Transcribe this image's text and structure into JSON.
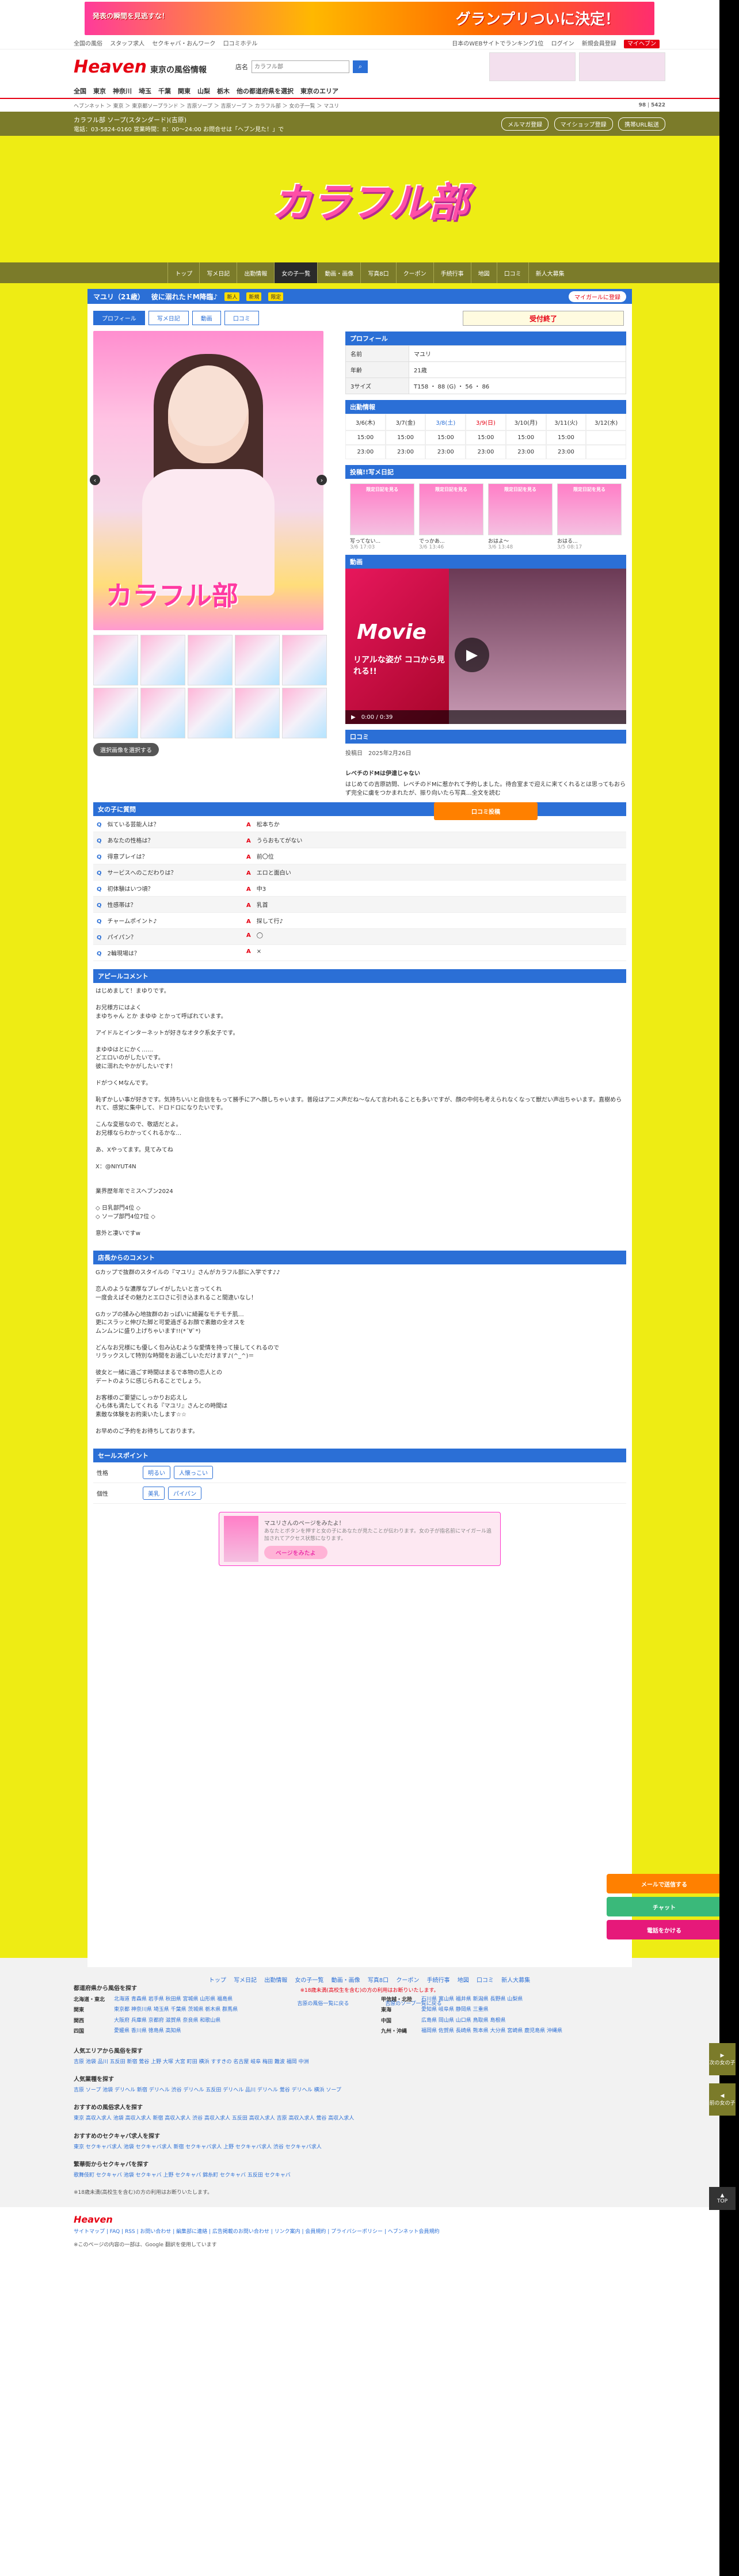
{
  "banner": {
    "left_text": "発表の瞬間を見逃すな！",
    "right_text": "グランプリついに決定！"
  },
  "topbar": {
    "left": [
      "全国の風俗",
      "スタッフ求人",
      "セクキャバ・おんワーク",
      "口コミホテル"
    ],
    "right": [
      "日本のWEBサイトでランキング1位",
      "ログイン",
      "新規会員登録",
      "マイヘブン"
    ]
  },
  "header": {
    "logo": "Heaven",
    "area": "東京の風俗情報",
    "search_label": "店名",
    "search_placeholder": "カラフル部"
  },
  "gnav": [
    "全国",
    "東京",
    "神奈川",
    "埼玉",
    "千葉",
    "関東",
    "山梨",
    "栃木",
    "他の都道府県を選択",
    "東京のエリア"
  ],
  "crumb": {
    "path": "ヘブンネット ＞ 東京 ＞ 東京都ソープランド ＞ 吉原ソープ ＞ 吉原ソープ ＞ カラフル部 ＞ 女の子一覧 ＞ マユリ",
    "count_a": "98",
    "count_b": "5422"
  },
  "shop": {
    "name": "カラフル部 ソープ(スタンダード)(吉原)",
    "tel": "電話：03-5824-0160 営業時間：8：00〜24:00 お問合せは「ヘブン見た！」で",
    "buttons": [
      "メルマガ登録",
      "マイショップ登録",
      "携帯URL転送"
    ]
  },
  "hero": {
    "logo": "カラフル部"
  },
  "shopnav": [
    "トップ",
    "写メ日記",
    "出勤情報",
    "女の子一覧",
    "動画・画像",
    "写真8口",
    "クーポン",
    "手続行事",
    "地図",
    "口コミ",
    "新人大募集"
  ],
  "girl": {
    "name": "マユリ（21歳）",
    "catch": "彼に溺れたドM降臨♪",
    "tags": [
      "新人",
      "新規",
      "限定"
    ],
    "fav": "マイガールに登録",
    "tabs": [
      "プロフィール",
      "写メ日記",
      "動画",
      "口コミ"
    ],
    "status": "受付終了",
    "photo_label": "カラフル部",
    "thumb_hint": "選択画像を選択する"
  },
  "profile": {
    "title": "プロフィール",
    "rows": [
      {
        "k": "名前",
        "v": "マユリ"
      },
      {
        "k": "年齢",
        "v": "21歳"
      },
      {
        "k": "3サイズ",
        "v": "T158 ・ 88 (G) ・ 56 ・ 86"
      }
    ]
  },
  "schedule": {
    "title": "出勤情報",
    "days": [
      "3/6(木)",
      "3/7(金)",
      "3/8(土)",
      "3/9(日)",
      "3/10(月)",
      "3/11(火)",
      "3/12(水)"
    ],
    "start": [
      "15:00",
      "15:00",
      "15:00",
      "15:00",
      "15:00",
      "15:00"
    ],
    "end": [
      "23:00",
      "23:00",
      "23:00",
      "23:00",
      "23:00",
      "23:00"
    ]
  },
  "diary": {
    "title": "投稿!!写メ日記",
    "items": [
      {
        "label": "限定日記を見る",
        "t": "写ってない...",
        "tm": "3/6 17:03"
      },
      {
        "label": "限定日記を見る",
        "t": "でっかあ...",
        "tm": "3/6 13:46"
      },
      {
        "label": "限定日記を見る",
        "t": "おはよ～",
        "tm": "3/6 13:48"
      },
      {
        "label": "限定日記を見る",
        "t": "おはる...",
        "tm": "3/5 08:17"
      }
    ]
  },
  "video": {
    "title": "動画",
    "m": "Movie",
    "s": "リアルな姿が ココから見れる!!",
    "time": "0:00 / 0:39"
  },
  "review": {
    "title": "口コミ",
    "date_label": "投稿日",
    "date": "2025年2月26日",
    "head": "レベチのドMは伊達じゃない",
    "text": "はじめての吉原訪問、レベチのドMに惹かれて予約しました。待合室まで迎えに来てくれるとは思ってもおらず完全に虜をつかまれたが、振り向いたら写真…全文を読む",
    "button": "口コミ投稿"
  },
  "qa": {
    "title": "女の子に質問",
    "rows": [
      {
        "q": "似ている芸能人は？",
        "a": "松本ちか"
      },
      {
        "q": "あなたの性格は？",
        "a": "うらおもてがない"
      },
      {
        "q": "得意プレイは？",
        "a": "前〇位"
      },
      {
        "q": "サービスへのこだわりは？",
        "a": "エロと面白い"
      },
      {
        "q": "初体験はいつ頃？",
        "a": "中3"
      },
      {
        "q": "性感帯は？",
        "a": "乳首"
      },
      {
        "q": "チャームポイント♪",
        "a": "探して行♪"
      },
      {
        "q": "パイパン？",
        "a": "◯"
      },
      {
        "q": "2輪現場は？",
        "a": "×"
      }
    ]
  },
  "appeal": {
    "title": "アピールコメント",
    "text": "はじめまして！まゆりです。\n\nお兄様方にはよく\nまゆちゃん とか まゆゆ とかって呼ばれています。\n\nアイドルとインターネットが好きなオタク系女子です。\n\nまゆゆはとにかく……\nどエロいのがしたいです。\n彼に溺れたやかがしたいです！\n\nドがつくMなんです。\n\n恥ずかしい事が好きです。気持ちいいと自信をもって勝手にアヘ顔しちゃいます。普段はアニメ声だね～なんて言われることも多いですが、顔の中何も考えられなくなって獣だい声出ちゃいます。直樹められて、感覚に集中して、ドロドロになりたいです。\n\nこんな変態なので、敬語だとよ。\nお兄様ならわかってくれるかな…\n\nあ、Xやってます。見てみてね\n\nX：@NIYUT4N\n\n\n業界歴年年でミスヘブン2024\n\n◇ 日乳部門4位 ◇\n◇ ソープ部門4位7位 ◇\n\n意外と凄いですw"
  },
  "shopcomment": {
    "title": "店長からのコメント",
    "text": "Gカップで抜群のスタイルの『マユリ』さんがカラフル部に入学です♪♪\n\n恋人のような濃厚なプレイがしたいと言ってくれ\n一度会えばその魅力とエロさに引き込まれること間違いなし！\n\nGカップの揉み心地抜群のおっぱいに綺麗なモチモチ肌…\n更にスラッと伸びた脚と可愛過ぎるお顔で素敵の全オスを\nムンムンに盛り上げちゃいます!!(*´∀`*)\n\nどんなお兄様にも優しく包み込むような愛情を持って接してくれるので\nリラックスして特別な時間をお過ごしいただけます♪(^_^)＝\n\n彼女と一緒に過ごす時間はまるで本物の恋人との\nデートのように感じられることでしょう。\n\nお客様のご要望にしっかりお応えし\n心も体も満たしてくれる『マユリ』さんとの時間は\n素敵な体験をお約束いたします☆☆\n\nお早めのご予約をお待ちしております。"
  },
  "sales": {
    "title": "セールスポイント",
    "rows": [
      {
        "k": "性格",
        "tags": [
          "明るい",
          "人懐っこい"
        ]
      },
      {
        "k": "個性",
        "tags": [
          "美乳",
          "パイパン"
        ]
      }
    ]
  },
  "share": {
    "t1": "マユリさんのページをみたよ！",
    "t2": "あなたとボタンを押すと女の子にあなたが見たことが伝わります。女の子が指名前にマイガール追加されてアクセス状態になります。",
    "btn": "ページをみたよ"
  },
  "footnav": {
    "links": [
      "トップ",
      "写メ日記",
      "出勤情報",
      "女の子一覧",
      "動画・画像",
      "写真8口",
      "クーポン",
      "手続行事",
      "地図",
      "口コミ",
      "新人大募集"
    ],
    "note": "※18歳未満(高校生を含む)の方の利用はお断りいたします。",
    "more": [
      "吉原の風俗一覧に戻る",
      "吉原のソープ一覧に戻る"
    ]
  },
  "floats": {
    "mail": "メールで送信する",
    "chat": "チャット",
    "call": "電話をかける"
  },
  "side": {
    "next": "次の女の子",
    "prev": "前の女の子",
    "top": "TOP"
  },
  "area": {
    "title1": "都道府県から風俗を探す",
    "regions_l": [
      {
        "k": "北海道・東北",
        "v": "北海道 青森県 岩手県 秋田県 宮城県 山形県 福島県"
      },
      {
        "k": "関東",
        "v": "東京都 神奈川県 埼玉県 千葉県 茨城県 栃木県 群馬県"
      },
      {
        "k": "関西",
        "v": "大阪府 兵庫県 京都府 滋賀県 奈良県 和歌山県"
      },
      {
        "k": "四国",
        "v": "愛媛県 香川県 徳島県 高知県"
      }
    ],
    "regions_r": [
      {
        "k": "甲信越・北陸",
        "v": "石川県 富山県 福井県 新潟県 長野県 山梨県"
      },
      {
        "k": "東海",
        "v": "愛知県 岐阜県 静岡県 三重県"
      },
      {
        "k": "中国",
        "v": "広島県 岡山県 山口県 鳥取県 島根県"
      },
      {
        "k": "九州・沖縄",
        "v": "福岡県 佐賀県 長崎県 熊本県 大分県 宮崎県 鹿児島県 沖縄県"
      }
    ],
    "title2": "人気エリアから風俗を探す",
    "t2": "吉原 池袋 品川 五反田 新宿 鶯谷 上野 大塚 大宮 町田 横浜 すすきの 名古屋 岐阜 梅田 難波 福岡 中洲",
    "title3": "人気業種を探す",
    "t3": "吉原 ソープ 池袋 デリヘル 新宿 デリヘル 渋谷 デリヘル 五反田 デリヘル 品川 デリヘル 鶯谷 デリヘル 横浜 ソープ",
    "title4": "おすすめの風俗求人を探す",
    "t4": "東京 高収入求人 池袋 高収入求人 新宿 高収入求人 渋谷 高収入求人 五反田 高収入求人 吉原 高収入求人 鶯谷 高収入求人",
    "title5": "おすすめのセクキャバ求人を探す",
    "t5": "東京 セクキャバ求人 池袋 セクキャバ求人 新宿 セクキャバ求人 上野 セクキャバ求人 渋谷 セクキャバ求人",
    "title6": "繁華街からセクキャバを探す",
    "t6": "歌舞伎町 セクキャバ 池袋 セクキャバ 上野 セクキャバ 錦糸町 セクキャバ 五反田 セクキャバ",
    "note": "※18歳未満(高校生を含む)の方の利用はお断りいたします。"
  },
  "bottom": {
    "links": "サイトマップ | FAQ | RSS | お問い合わせ | 編集部に連絡 | 広告掲載のお問い合わせ | リンク案内 | 会員規約 | プライバシーポリシー | ヘブンネット会員規約",
    "copy": "※このページの内容の一部は、Google 翻訳を使用しています"
  }
}
